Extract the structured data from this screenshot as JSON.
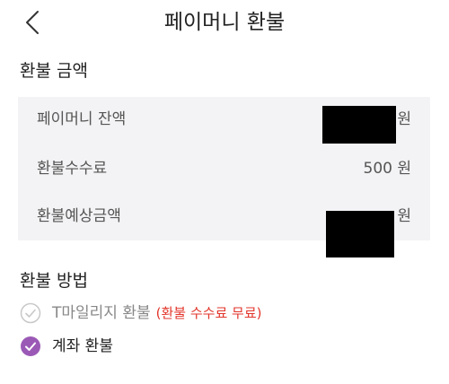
{
  "header": {
    "title": "페이머니 환불",
    "back_icon": "chevron-left-icon"
  },
  "amount_section": {
    "title": "환불 금액",
    "rows": [
      {
        "label": "페이머니 잔액",
        "value": "",
        "unit": "원"
      },
      {
        "label": "환불수수료",
        "value": "500",
        "unit": "원"
      },
      {
        "label": "환불예상금액",
        "value": "",
        "unit": "원"
      }
    ]
  },
  "method_section": {
    "title": "환불 방법",
    "options": [
      {
        "label": "T마일리지 환불",
        "note": "(환불 수수료 무료)",
        "state": "disabled"
      },
      {
        "label": "계좌 환불",
        "state": "selected"
      }
    ]
  },
  "colors": {
    "accent": "#9b59b6",
    "note_red": "#e2362b",
    "box_bg": "#f3f3f5"
  }
}
